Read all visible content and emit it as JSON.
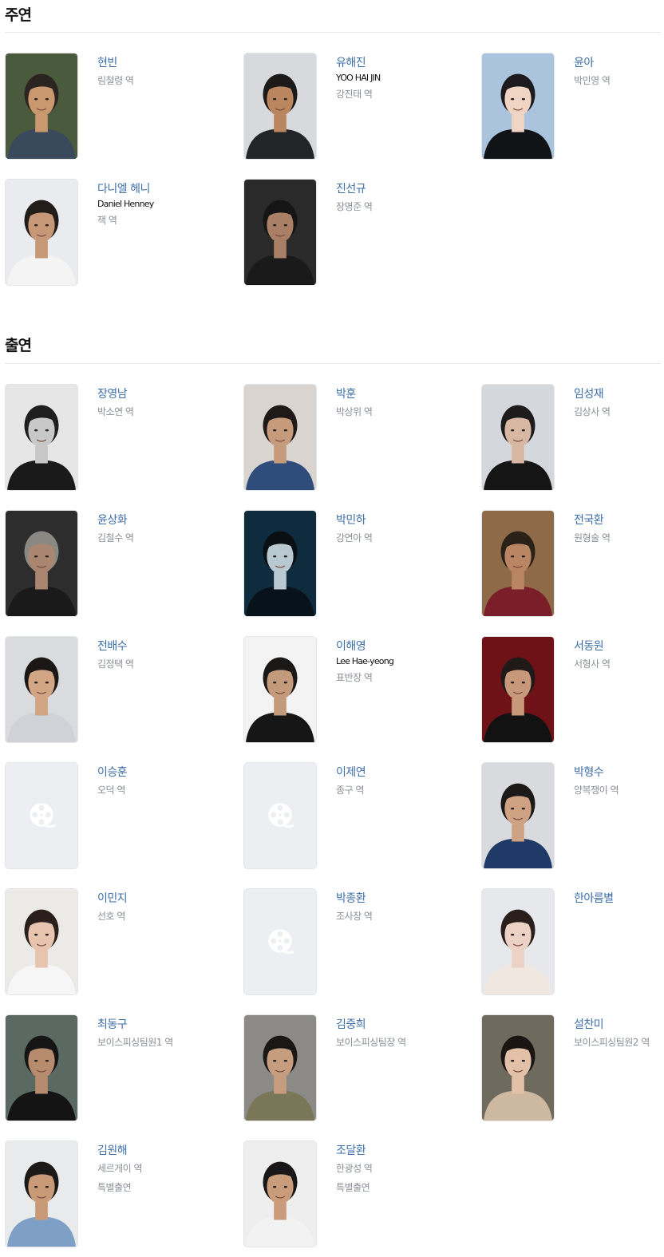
{
  "sections": [
    {
      "title": "주연",
      "cast": [
        {
          "name": "현빈",
          "role": "림철령 역",
          "photo": "photo",
          "bg": "#4a5a3c",
          "skin": "#c9986e",
          "hair": "#2b2420",
          "cloth": "#3a4a5c"
        },
        {
          "name": "유해진",
          "english": "YOO HAI JIN",
          "role": "강진태 역",
          "photo": "photo",
          "bg": "#d7d9dc",
          "skin": "#b98660",
          "hair": "#1c1a19",
          "cloth": "#222426"
        },
        {
          "name": "윤아",
          "role": "박민영 역",
          "photo": "photo",
          "bg": "#a9c4dc",
          "skin": "#f0d4c4",
          "hair": "#1c1a1d",
          "cloth": "#121316"
        },
        {
          "name": "다니엘 헤니",
          "english": "Daniel Henney",
          "role": "잭 역",
          "photo": "photo",
          "bg": "#e9ebee",
          "skin": "#c69877",
          "hair": "#231d1a",
          "cloth": "#f4f4f4"
        },
        {
          "name": "진선규",
          "role": "장명준 역",
          "photo": "photo",
          "bg": "#2a2a2a",
          "skin": "#a98066",
          "hair": "#151515",
          "cloth": "#1a1a1a"
        }
      ]
    },
    {
      "title": "출연",
      "cast": [
        {
          "name": "장영남",
          "role": "박소연 역",
          "photo": "photo",
          "bg": "#e6e6e6",
          "skin": "#c8c8c8",
          "hair": "#1e1e1e",
          "cloth": "#1a1a1a"
        },
        {
          "name": "박훈",
          "role": "박상위 역",
          "photo": "photo",
          "bg": "#d9d4cf",
          "skin": "#c59b7c",
          "hair": "#1f1a17",
          "cloth": "#2f4d7a"
        },
        {
          "name": "임성재",
          "role": "김상사 역",
          "photo": "photo",
          "bg": "#d4d7dc",
          "skin": "#d8b8a2",
          "hair": "#1d1b1b",
          "cloth": "#151515"
        },
        {
          "name": "윤상화",
          "role": "김철수 역",
          "photo": "photo",
          "bg": "#2d2d2d",
          "skin": "#a8866f",
          "hair": "#8a8883",
          "cloth": "#1a1a1a"
        },
        {
          "name": "박민하",
          "role": "강연아 역",
          "photo": "photo",
          "bg": "#0f2c3e",
          "skin": "#b9c9d2",
          "hair": "#0a0f14",
          "cloth": "#08121a"
        },
        {
          "name": "전국환",
          "role": "원형술 역",
          "photo": "photo",
          "bg": "#8e6a48",
          "skin": "#b98563",
          "hair": "#2a2119",
          "cloth": "#7a1f2a"
        },
        {
          "name": "전배수",
          "role": "김정택 역",
          "photo": "photo",
          "bg": "#d9dbde",
          "skin": "#d2a585",
          "hair": "#1a1716",
          "cloth": "#cfd3d8"
        },
        {
          "name": "이해영",
          "english": "Lee Hae-yeong",
          "role": "표반장 역",
          "photo": "photo",
          "bg": "#f3f3f3",
          "skin": "#c49a7d",
          "hair": "#1b1818",
          "cloth": "#161616"
        },
        {
          "name": "서동원",
          "role": "서형사 역",
          "photo": "photo",
          "bg": "#6e1218",
          "skin": "#c7987a",
          "hair": "#1f1a17",
          "cloth": "#121212"
        },
        {
          "name": "이승훈",
          "role": "오덕 역",
          "photo": "placeholder"
        },
        {
          "name": "이제연",
          "role": "종구 역",
          "photo": "placeholder"
        },
        {
          "name": "박형수",
          "role": "양복쟁이 역",
          "photo": "photo",
          "bg": "#d8dade",
          "skin": "#cfa284",
          "hair": "#1c1a19",
          "cloth": "#1f3a66"
        },
        {
          "name": "이민지",
          "role": "선호 역",
          "photo": "photo",
          "bg": "#eceae6",
          "skin": "#e6c4ae",
          "hair": "#2a1f1b",
          "cloth": "#f6f6f6"
        },
        {
          "name": "박종환",
          "role": "조사장 역",
          "photo": "placeholder"
        },
        {
          "name": "한아름별",
          "photo": "photo",
          "bg": "#e6e8ec",
          "skin": "#ecd2c4",
          "hair": "#2b1f1c",
          "cloth": "#f1e7e1"
        },
        {
          "name": "최동구",
          "role": "보이스피싱팀원1 역",
          "photo": "photo",
          "bg": "#5a6a62",
          "skin": "#b78c6e",
          "hair": "#151515",
          "cloth": "#141414"
        },
        {
          "name": "김중희",
          "role": "보이스피싱팀장 역",
          "photo": "photo",
          "bg": "#8c8a86",
          "skin": "#c79d7f",
          "hair": "#1a1816",
          "cloth": "#7a7658"
        },
        {
          "name": "설찬미",
          "role": "보이스피싱팀원2 역",
          "photo": "photo",
          "bg": "#6e6a5e",
          "skin": "#e2c1a8",
          "hair": "#1a1512",
          "cloth": "#cdb9a2"
        },
        {
          "name": "김원해",
          "role": "세르게이 역",
          "note": "특별출연",
          "photo": "photo",
          "bg": "#e8eaec",
          "skin": "#c89a78",
          "hair": "#1c1a18",
          "cloth": "#7fa0c6"
        },
        {
          "name": "조달환",
          "role": "한광성 역",
          "note": "특별출연",
          "photo": "photo",
          "bg": "#eeeeee",
          "skin": "#c99c7b",
          "hair": "#181616",
          "cloth": "#f2f2f2"
        }
      ]
    }
  ]
}
